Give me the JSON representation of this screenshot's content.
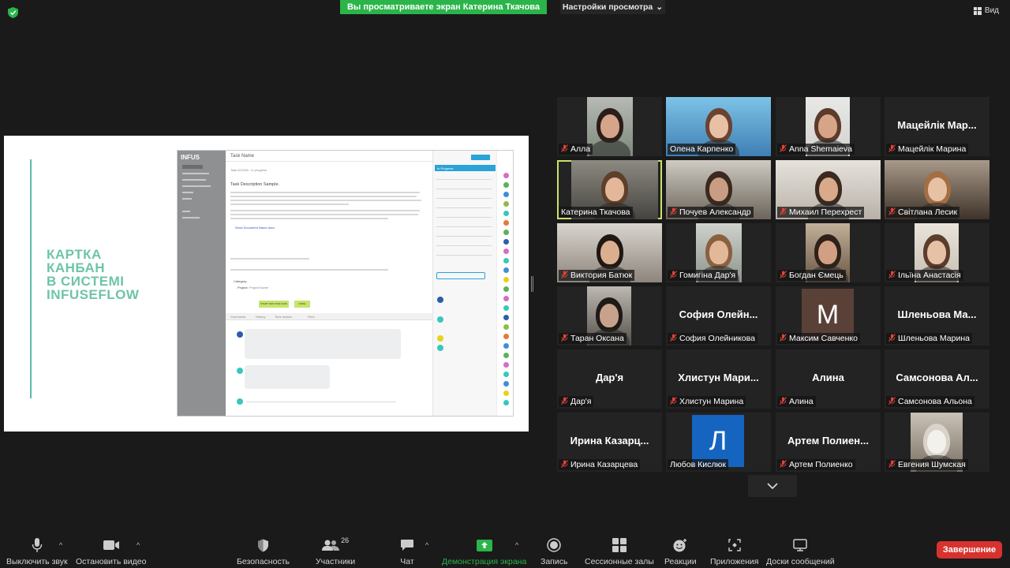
{
  "top": {
    "share_banner": "Вы просматриваете экран Катерина Ткачова",
    "view_settings": "Настройки просмотра",
    "view_button": "Вид"
  },
  "slide": {
    "title_lines": [
      "КАРТКА",
      "КАНБАН",
      "В СИСТЕМІ",
      "INFUSEFLOW"
    ],
    "app": {
      "logo": "INFUS",
      "task_name": "Task Name",
      "task_id": "Task #12345 · In progress",
      "description_title": "Task Description Sample.",
      "attachment": "Word Document Name.docx",
      "category_label": "Category:",
      "project_label": "Project:",
      "project_value": "Project Name",
      "start_button": "START THIS TASK NOW",
      "done_button": "DONE",
      "tabs": [
        "Comments",
        "History",
        "Time tracker",
        "Files"
      ],
      "status_bar": "In Progress"
    }
  },
  "participants": [
    {
      "name": "Алла",
      "muted": true
    },
    {
      "name": "Олена Карпенко",
      "muted": false
    },
    {
      "name": "Anna Shemaieva",
      "muted": true
    },
    {
      "name": "Мацейлік Марина",
      "big": "Мацейлік Мар...",
      "muted": true
    },
    {
      "name": "Катерина Ткачова",
      "muted": false,
      "active": true
    },
    {
      "name": "Почуев Александр",
      "muted": true
    },
    {
      "name": "Михаил Перехрест",
      "muted": true
    },
    {
      "name": "Світлана Лесик",
      "muted": true
    },
    {
      "name": "Виктория Батюк",
      "muted": true
    },
    {
      "name": "Гомигіна Дар'я",
      "muted": true
    },
    {
      "name": "Богдан Ємець",
      "muted": true
    },
    {
      "name": "Ільїна Анастасія",
      "muted": true
    },
    {
      "name": "Таран Оксана",
      "muted": true
    },
    {
      "name": "София Олейникова",
      "big": "София Олейн...",
      "muted": true
    },
    {
      "name": "Максим Савченко",
      "initial": "M",
      "muted": true
    },
    {
      "name": "Шленьова Марина",
      "big": "Шленьова Ма...",
      "muted": true
    },
    {
      "name": "Дар'я",
      "big": "Дар'я",
      "muted": true
    },
    {
      "name": "Хлистун Марина",
      "big": "Хлистун Мари...",
      "muted": true
    },
    {
      "name": "Алина",
      "big": "Алина",
      "muted": true
    },
    {
      "name": "Самсонова Альона",
      "big": "Самсонова Ал...",
      "muted": true
    },
    {
      "name": "Ирина Казарцева",
      "big": "Ирина Казарц...",
      "muted": true
    },
    {
      "name": "Любов Кислюк",
      "initial": "Л",
      "muted": false
    },
    {
      "name": "Артем Полиенко",
      "big": "Артем Полиен...",
      "muted": true
    },
    {
      "name": "Евгения Шумская",
      "muted": true
    }
  ],
  "toolbar": {
    "mute": "Выключить звук",
    "video": "Остановить видео",
    "security": "Безопасность",
    "participants": "Участники",
    "participants_count": "26",
    "chat": "Чат",
    "share": "Демонстрация экрана",
    "record": "Запись",
    "breakout": "Сессионные залы",
    "reactions": "Реакции",
    "apps": "Приложения",
    "whiteboard": "Доски сообщений",
    "end": "Завершение"
  },
  "colors": {
    "accent_green": "#2bb44a",
    "end_red": "#d7322e",
    "active_border": "#c9e26a",
    "slide_title": "#6ec4a9"
  }
}
